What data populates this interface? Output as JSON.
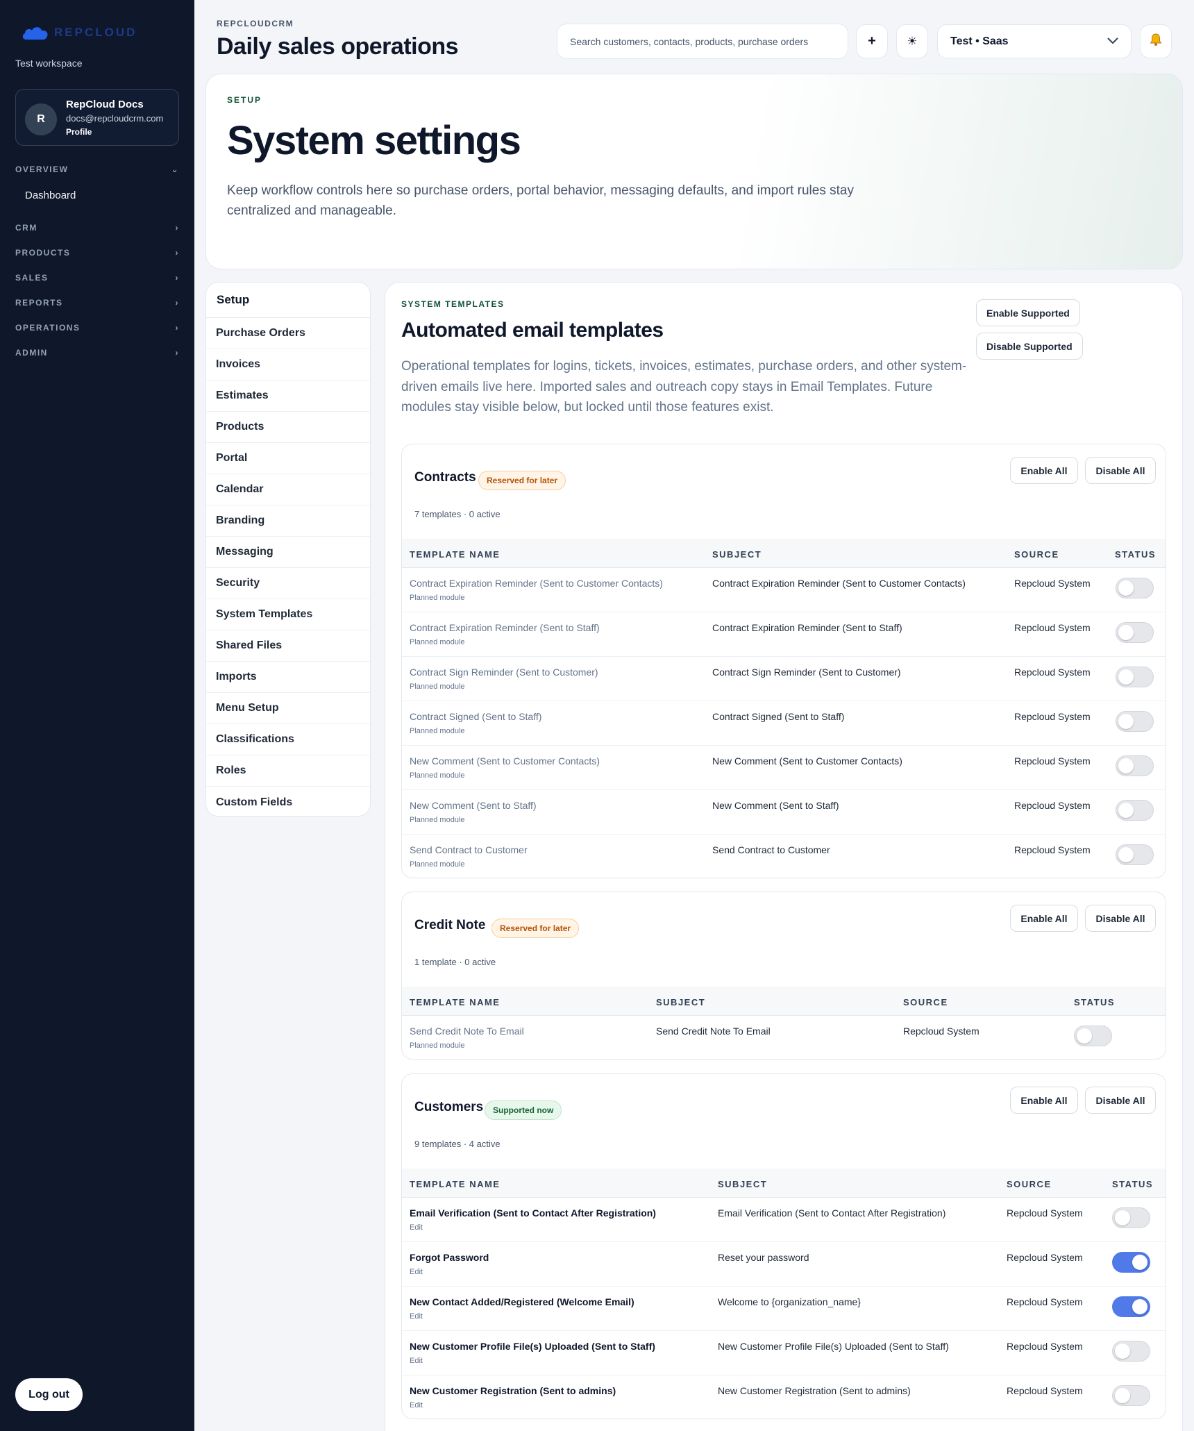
{
  "brand": {
    "name": "REPCLOUD",
    "workspace": "Test workspace"
  },
  "profile": {
    "initial": "R",
    "name": "RepCloud Docs",
    "email": "docs@repcloudcrm.com",
    "link": "Profile"
  },
  "nav": {
    "overview": "OVERVIEW",
    "dashboard": "Dashboard",
    "sections": [
      "CRM",
      "PRODUCTS",
      "SALES",
      "REPORTS",
      "OPERATIONS",
      "ADMIN"
    ]
  },
  "logout": "Log out",
  "header": {
    "eyebrow": "REPCLOUDCRM",
    "title": "Daily sales operations",
    "search_placeholder": "Search customers, contacts, products, purchase orders",
    "workspace_select": "Test • Saas"
  },
  "hero": {
    "eyebrow": "SETUP",
    "title": "System settings",
    "description": "Keep workflow controls here so purchase orders, portal behavior, messaging defaults, and import rules stay centralized and manageable."
  },
  "setup_nav": {
    "header": "Setup",
    "items": [
      "Purchase Orders",
      "Invoices",
      "Estimates",
      "Products",
      "Portal",
      "Calendar",
      "Branding",
      "Messaging",
      "Security",
      "System Templates",
      "Shared Files",
      "Imports",
      "Menu Setup",
      "Classifications",
      "Roles",
      "Custom Fields"
    ]
  },
  "main": {
    "eyebrow": "SYSTEM TEMPLATES",
    "title": "Automated email templates",
    "description": "Operational templates for logins, tickets, invoices, estimates, purchase orders, and other system-driven emails live here. Imported sales and outreach copy stays in Email Templates. Future modules stay visible below, but locked until those features exist.",
    "enable_supported": "Enable Supported",
    "disable_supported": "Disable Supported"
  },
  "columns": {
    "name": "TEMPLATE NAME",
    "subject": "SUBJECT",
    "source": "SOURCE",
    "status": "STATUS"
  },
  "group_buttons": {
    "enable_all": "Enable All",
    "disable_all": "Disable All"
  },
  "groups": [
    {
      "title": "Contracts",
      "badge": "Reserved for later",
      "count": "7 templates · 0 active",
      "rows": [
        {
          "name": "Contract Expiration Reminder (Sent to Customer Contacts)",
          "note": "Planned module",
          "subject": "Contract Expiration Reminder (Sent to Customer Contacts)",
          "source": "Repcloud System",
          "enabled": false
        },
        {
          "name": "Contract Expiration Reminder (Sent to Staff)",
          "note": "Planned module",
          "subject": "Contract Expiration Reminder (Sent to Staff)",
          "source": "Repcloud System",
          "enabled": false
        },
        {
          "name": "Contract Sign Reminder (Sent to Customer)",
          "note": "Planned module",
          "subject": "Contract Sign Reminder (Sent to Customer)",
          "source": "Repcloud System",
          "enabled": false
        },
        {
          "name": "Contract Signed (Sent to Staff)",
          "note": "Planned module",
          "subject": "Contract Signed (Sent to Staff)",
          "source": "Repcloud System",
          "enabled": false
        },
        {
          "name": "New Comment (Sent to Customer Contacts)",
          "note": "Planned module",
          "subject": "New Comment (Sent to Customer Contacts)",
          "source": "Repcloud System",
          "enabled": false
        },
        {
          "name": "New Comment (Sent to Staff)",
          "note": "Planned module",
          "subject": "New Comment (Sent to Staff)",
          "source": "Repcloud System",
          "enabled": false
        },
        {
          "name": "Send Contract to Customer",
          "note": "Planned module",
          "subject": "Send Contract to Customer",
          "source": "Repcloud System",
          "enabled": false
        }
      ]
    },
    {
      "title": "Credit Note",
      "badge": "Reserved for later",
      "count": "1 template · 0 active",
      "rows": [
        {
          "name": "Send Credit Note To Email",
          "note": "Planned module",
          "subject": "Send Credit Note To Email",
          "source": "Repcloud System",
          "enabled": false
        }
      ]
    },
    {
      "title": "Customers",
      "badge": "Supported now",
      "count": "9 templates · 4 active",
      "rows": [
        {
          "name": "Email Verification (Sent to Contact After Registration)",
          "note": "Edit",
          "subject": "Email Verification (Sent to Contact After Registration)",
          "source": "Repcloud System",
          "enabled": false
        },
        {
          "name": "Forgot Password",
          "note": "Edit",
          "subject": "Reset your password",
          "source": "Repcloud System",
          "enabled": true
        },
        {
          "name": "New Contact Added/Registered (Welcome Email)",
          "note": "Edit",
          "subject": "Welcome to {organization_name}",
          "source": "Repcloud System",
          "enabled": true
        },
        {
          "name": "New Customer Profile File(s) Uploaded (Sent to Staff)",
          "note": "Edit",
          "subject": "New Customer Profile File(s) Uploaded (Sent to Staff)",
          "source": "Repcloud System",
          "enabled": false
        },
        {
          "name": "New Customer Registration (Sent to admins)",
          "note": "Edit",
          "subject": "New Customer Registration (Sent to admins)",
          "source": "Repcloud System",
          "enabled": false
        }
      ]
    }
  ]
}
